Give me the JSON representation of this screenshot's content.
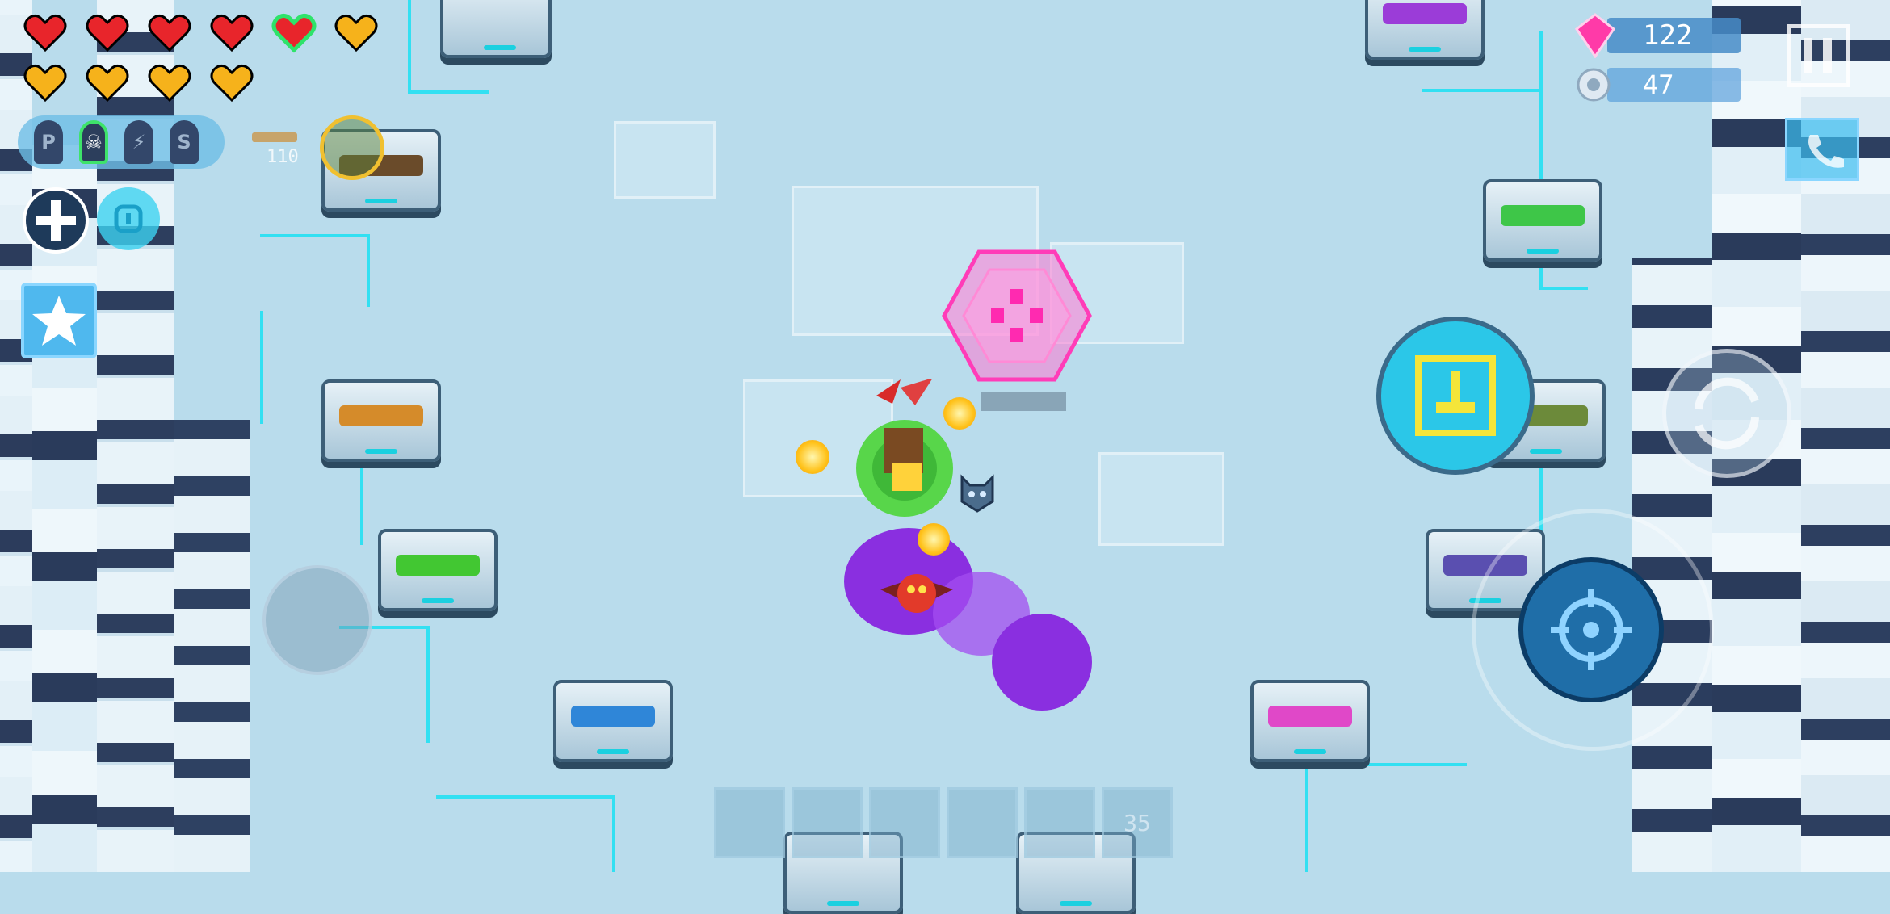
{
  "hud": {
    "health": {
      "hearts": [
        {
          "type": "red"
        },
        {
          "type": "red"
        },
        {
          "type": "red"
        },
        {
          "type": "red"
        },
        {
          "type": "red",
          "highlighted": true
        },
        {
          "type": "gold"
        },
        {
          "type": "gold"
        },
        {
          "type": "gold"
        },
        {
          "type": "gold"
        },
        {
          "type": "gold"
        }
      ],
      "colors": {
        "red": "#e8252b",
        "gold": "#f6b21b",
        "highlight": "#2ee36a"
      }
    },
    "ammo_tabs": {
      "items": [
        {
          "label": "P",
          "selected": false
        },
        {
          "label": "☠",
          "selected": true
        },
        {
          "label": "⚡",
          "selected": false
        },
        {
          "label": "S",
          "selected": false
        }
      ]
    },
    "equipped_weapon": {
      "ammo": "110",
      "icon": "rifle-icon"
    },
    "skill_buttons": [
      {
        "icon": "plus-cross-icon"
      },
      {
        "icon": "shield-icon"
      },
      {
        "icon": "star-icon"
      }
    ],
    "currency": {
      "gems": "122",
      "gems_icon": "gem-icon",
      "gems_color": "#ff3aa8",
      "parts": "47",
      "parts_icon": "gear-parts-icon"
    },
    "pause_icon": "pause-icon",
    "chat_icon": "phone-icon"
  },
  "controls": {
    "joystick_icon": "move-joystick",
    "interact_icon": "pickup-hand-icon",
    "swap_icon": "swap-weapon-icon",
    "attack_icon": "crosshair-icon"
  },
  "bottom_bar": {
    "slots": [
      {
        "icon": "locked-slot-icon"
      },
      {
        "icon": "heart-slot-icon"
      },
      {
        "icon": "sword-slot-icon"
      },
      {
        "icon": "crossed-swords-icon"
      },
      {
        "icon": "drone-slot-icon"
      },
      {
        "label": "35"
      }
    ]
  },
  "world": {
    "teleporter_color": "#ff3cb8",
    "weapon_pedestals": [
      {
        "gun_color": "#9b3cd8"
      },
      {
        "gun_color": "#6a4b2a"
      },
      {
        "gun_color": "#d58b2a"
      },
      {
        "gun_color": "#42c732"
      },
      {
        "gun_color": "#2f86d8"
      },
      {
        "gun_color": "#3ec648"
      },
      {
        "gun_color": "#e048c8"
      },
      {
        "gun_color": "#5a4fb0"
      },
      {
        "gun_color": "#6c8a3a"
      }
    ]
  }
}
